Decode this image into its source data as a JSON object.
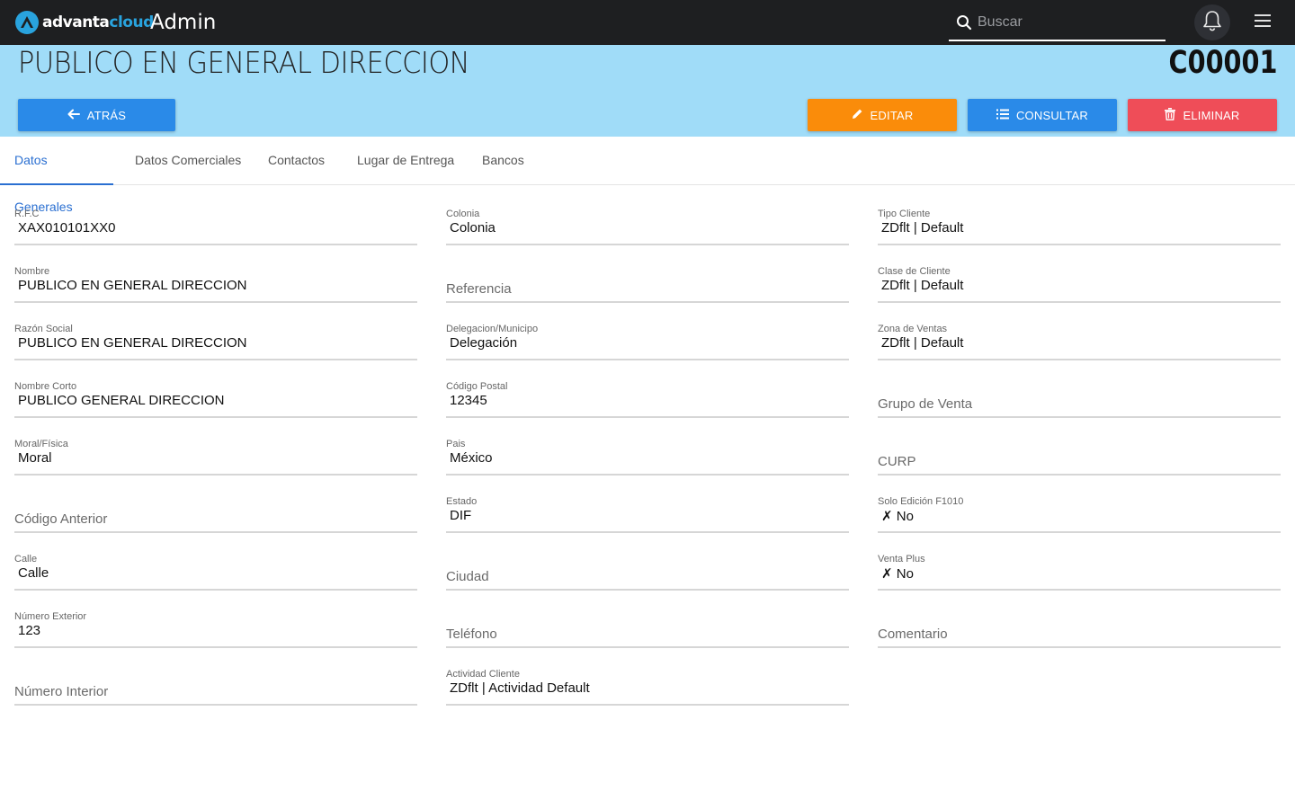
{
  "header": {
    "logo_primary": "advanta",
    "logo_secondary": "cloud",
    "app_title": "Admin",
    "search_placeholder": "Buscar",
    "search_value": ""
  },
  "record": {
    "title": "PUBLICO EN GENERAL DIRECCION",
    "code": "C00001"
  },
  "actions": {
    "back_label": "ATRÁS",
    "edit_label": "EDITAR",
    "consult_label": "CONSULTAR",
    "delete_label": "ELIMINAR"
  },
  "tabs": [
    {
      "label": "Datos Generales",
      "active": true
    },
    {
      "label": "Datos Comerciales",
      "active": false
    },
    {
      "label": "Contactos",
      "active": false
    },
    {
      "label": "Lugar de Entrega",
      "active": false
    },
    {
      "label": "Bancos",
      "active": false
    }
  ],
  "fields": {
    "col1": [
      {
        "label": "R.F.C",
        "value": "XAX010101XX0"
      },
      {
        "label": "Nombre",
        "value": "PUBLICO EN GENERAL DIRECCION"
      },
      {
        "label": "Razón Social",
        "value": "PUBLICO EN GENERAL DIRECCION"
      },
      {
        "label": "Nombre Corto",
        "value": "PUBLICO GENERAL DIRECCION"
      },
      {
        "label": "Moral/Física",
        "value": "Moral"
      },
      {
        "label": "Código Anterior",
        "value": ""
      },
      {
        "label": "Calle",
        "value": "Calle"
      },
      {
        "label": "Número Exterior",
        "value": "123"
      },
      {
        "label": "Número Interior",
        "value": ""
      }
    ],
    "col2": [
      {
        "label": "Colonia",
        "value": "Colonia"
      },
      {
        "label": "Referencia",
        "value": ""
      },
      {
        "label": "Delegacion/Municipo",
        "value": "Delegación"
      },
      {
        "label": "Código Postal",
        "value": "12345"
      },
      {
        "label": "Pais",
        "value": "México"
      },
      {
        "label": "Estado",
        "value": "DIF"
      },
      {
        "label": "Ciudad",
        "value": ""
      },
      {
        "label": "Teléfono",
        "value": ""
      },
      {
        "label": "Actividad Cliente",
        "value": "ZDflt | Actividad Default"
      }
    ],
    "col3": [
      {
        "label": "Tipo Cliente",
        "value": "ZDflt | Default"
      },
      {
        "label": "Clase de Cliente",
        "value": "ZDflt | Default"
      },
      {
        "label": "Zona de Ventas",
        "value": "ZDflt | Default"
      },
      {
        "label": "Grupo de Venta",
        "value": ""
      },
      {
        "label": "CURP",
        "value": ""
      },
      {
        "label": "Solo Edición F1010",
        "value": "✗ No"
      },
      {
        "label": "Venta Plus",
        "value": "✗ No"
      },
      {
        "label": "Comentario",
        "value": ""
      }
    ]
  },
  "colors": {
    "topbar": "#1e1f21",
    "band": "#a0dcf8",
    "primary": "#2a8ae8",
    "warning": "#fa8c0a",
    "danger": "#ef4d58",
    "tab_active": "#2a6fd1"
  }
}
